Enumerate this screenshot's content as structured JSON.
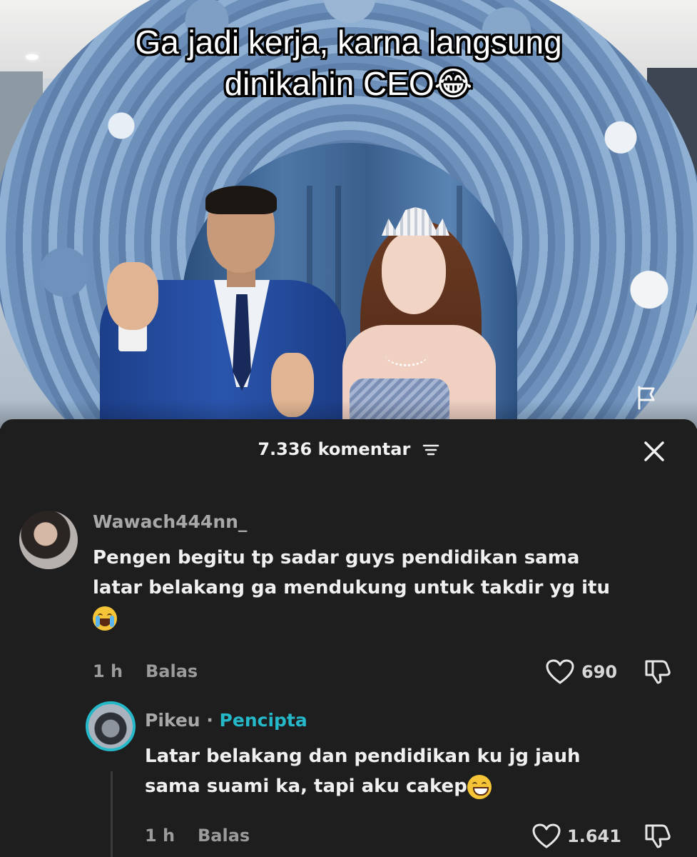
{
  "video": {
    "caption_line1": "Ga jadi kerja, karna langsung",
    "caption_line2": "dinikahin CEO😂"
  },
  "comments_header": {
    "count_label": "7.336 komentar"
  },
  "comments": [
    {
      "username": "Wawach444nn_",
      "text_line1": "Pengen begitu tp sadar guys pendidikan sama",
      "text_line2": "latar belakang ga mendukung untuk takdir yg itu",
      "emoji": "crying-face",
      "time": "1 h",
      "reply_label": "Balas",
      "likes": "690"
    },
    {
      "username": "Pikeu",
      "separator": "·",
      "badge": "Pencipta",
      "text_line1": "Latar belakang dan pendidikan ku jg jauh",
      "text_line2": "sama suami ka, tapi aku cakep",
      "emoji": "grinning-face",
      "time": "1 h",
      "reply_label": "Balas",
      "likes": "1.641"
    }
  ],
  "colors": {
    "sheet_bg": "#1e1e1f",
    "creator_accent": "#25b8c9"
  }
}
